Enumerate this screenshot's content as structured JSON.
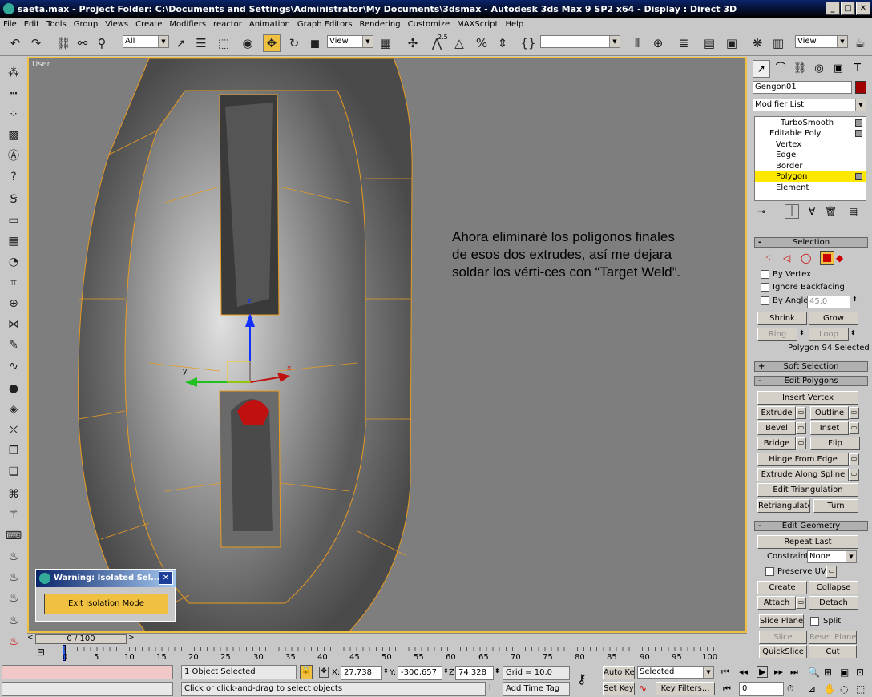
{
  "window": {
    "title": "saeta.max     - Project Folder: C:\\Documents and Settings\\Administrator\\My Documents\\3dsmax     - Autodesk 3ds Max 9 SP2 x64     - Display : Direct 3D"
  },
  "menu": [
    "File",
    "Edit",
    "Tools",
    "Group",
    "Views",
    "Create",
    "Modifiers",
    "reactor",
    "Animation",
    "Graph Editors",
    "Rendering",
    "Customize",
    "MAXScript",
    "Help"
  ],
  "toolbar": {
    "selection_filter": "All",
    "ref_coord": "View",
    "angle_snap": "2.5",
    "named_sel": "",
    "render_view": "View"
  },
  "viewport": {
    "label": "User",
    "annotation": "Ahora eliminaré los polígonos finales de esos dos extrudes, así me dejara soldar los vérti-ces con “Target Weld”.",
    "axis_x": "x",
    "axis_y": "y",
    "axis_z": "z"
  },
  "isolation_dialog": {
    "title": "Warning: Isolated Sel...",
    "button": "Exit Isolation Mode"
  },
  "command_panel": {
    "object_name": "Gengon01",
    "object_color": "#a00000",
    "modifier_list": "Modifier List",
    "stack": [
      "TurboSmooth",
      "Editable Poly",
      "Vertex",
      "Edge",
      "Border",
      "Polygon",
      "Element"
    ],
    "selection": {
      "title": "Selection",
      "by_vertex": "By Vertex",
      "ignore_backfacing": "Ignore Backfacing",
      "by_angle": "By Angle:",
      "angle_value": "45,0",
      "shrink": "Shrink",
      "grow": "Grow",
      "ring": "Ring",
      "loop": "Loop",
      "status": "Polygon 94 Selected"
    },
    "soft_selection": "Soft Selection",
    "edit_polygons": {
      "title": "Edit Polygons",
      "insert_vertex": "Insert Vertex",
      "extrude": "Extrude",
      "outline": "Outline",
      "bevel": "Bevel",
      "inset": "Inset",
      "bridge": "Bridge",
      "flip": "Flip",
      "hinge": "Hinge From Edge",
      "extrude_spline": "Extrude Along Spline",
      "edit_tri": "Edit Triangulation",
      "retriangulate": "Retriangulate",
      "turn": "Turn"
    },
    "edit_geometry": {
      "title": "Edit Geometry",
      "repeat_last": "Repeat Last",
      "constraints": "Constraints:",
      "constraints_value": "None",
      "preserve_uvs": "Preserve UVs",
      "create": "Create",
      "collapse": "Collapse",
      "attach": "Attach",
      "detach": "Detach",
      "slice_plane": "Slice Plane",
      "split": "Split",
      "slice": "Slice",
      "reset_plane": "Reset Plane",
      "quickslice": "QuickSlice",
      "cut": "Cut"
    }
  },
  "timeline": {
    "slider": "0 / 100",
    "ticks": [
      "0",
      "5",
      "10",
      "15",
      "20",
      "25",
      "30",
      "35",
      "40",
      "45",
      "50",
      "55",
      "60",
      "65",
      "70",
      "75",
      "80",
      "85",
      "90",
      "95",
      "100"
    ]
  },
  "status": {
    "selected": "1 Object Selected",
    "prompt": "Click or click-and-drag to select objects",
    "x_label": "X:",
    "x": "27,738",
    "y_label": "Y:",
    "y": "-300,657",
    "z_label": "Z:",
    "z": "74,328",
    "grid": "Grid = 10,0",
    "add_time_tag": "Add Time Tag",
    "auto_key": "Auto Key",
    "set_key": "Set Key",
    "key_mode": "Selected",
    "key_filters": "Key Filters...",
    "frame": "0"
  }
}
